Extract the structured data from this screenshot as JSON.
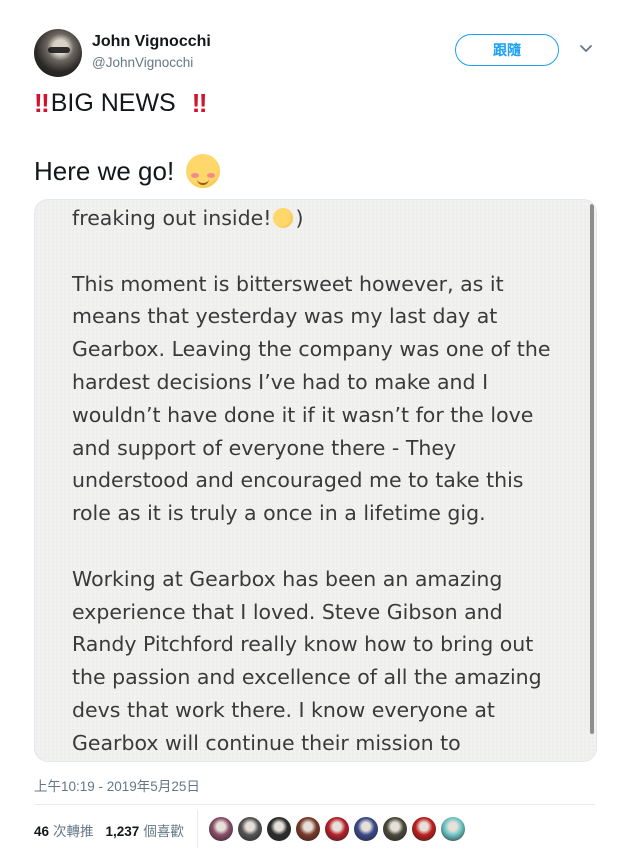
{
  "tweet": {
    "author_name": "John Vignocchi",
    "author_handle": "@JohnVignocchi",
    "follow_label": "跟隨",
    "headline_text": "BIG NEWS",
    "line2_text": "Here we go!",
    "bang_glyph": "‼",
    "timestamp": "上午10:19 - 2019年5月25日"
  },
  "media": {
    "line1": "freaking out inside!",
    "line1_end": ")",
    "para1": [
      "This moment is bittersweet however, as it",
      "means that yesterday was my last day at",
      "Gearbox. Leaving the company was one of the",
      "hardest decisions I’ve had to make and I",
      "wouldn’t have done it if it wasn’t for the love",
      "and support of everyone there - They",
      "understood and encouraged me to take this",
      "role as it is truly a once in a lifetime gig."
    ],
    "para2": [
      "Working at Gearbox has been an amazing",
      "experience that I loved. Steve Gibson and",
      "Randy Pitchford really know how to bring out",
      "the passion and excellence of all the amazing",
      "devs that work there. I know everyone at",
      "Gearbox will continue their mission to"
    ]
  },
  "stats": {
    "retweet_count": "46",
    "retweet_label": "次轉推",
    "like_count": "1,237",
    "like_label": "個喜歡"
  },
  "likers": [
    {
      "name": "liker-avatar-1",
      "color": "#8a4f6a"
    },
    {
      "name": "liker-avatar-2",
      "color": "#555555"
    },
    {
      "name": "liker-avatar-3",
      "color": "#2d2d2d"
    },
    {
      "name": "liker-avatar-4",
      "color": "#7a3a2a"
    },
    {
      "name": "liker-avatar-5",
      "color": "#b8202a"
    },
    {
      "name": "liker-avatar-6",
      "color": "#3a4a8a"
    },
    {
      "name": "liker-avatar-7",
      "color": "#4a4a3a"
    },
    {
      "name": "liker-avatar-8",
      "color": "#c02020"
    },
    {
      "name": "liker-avatar-9",
      "color": "#6fc7c7"
    }
  ],
  "colors": {
    "accent": "#1da1f2",
    "secondary_text": "#657786",
    "alert_red": "#d0142f"
  }
}
